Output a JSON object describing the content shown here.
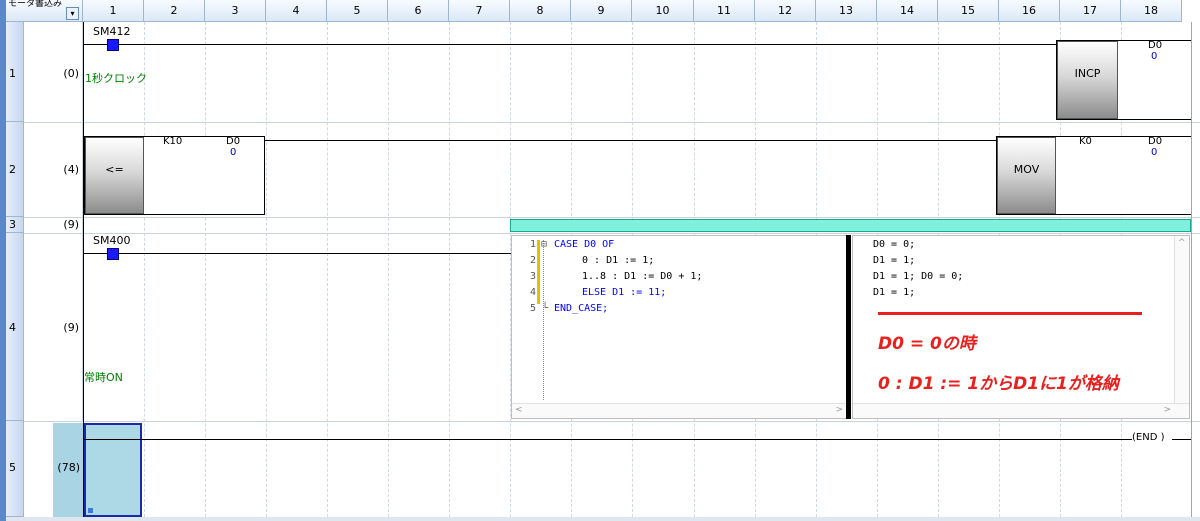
{
  "header": {
    "first_col": "モータ書込み",
    "dropdown_glyph": "▾",
    "columns": [
      "1",
      "2",
      "3",
      "4",
      "5",
      "6",
      "7",
      "8",
      "9",
      "10",
      "11",
      "12",
      "13",
      "14",
      "15",
      "16",
      "17",
      "18"
    ]
  },
  "rows": [
    {
      "no": "1",
      "step": "(0)"
    },
    {
      "no": "2",
      "step": "(4)"
    },
    {
      "no": "3",
      "step": "(9)"
    },
    {
      "no": "4",
      "step": "(9)"
    },
    {
      "no": "5",
      "step": "(78)"
    }
  ],
  "rung1": {
    "contact_device": "SM412",
    "contact_comment": "1秒クロック",
    "instruction": "INCP",
    "operand": "D0",
    "operand_value": "0"
  },
  "rung2": {
    "instruction": "<=",
    "operand1": "K10",
    "operand2": "D0",
    "operand2_value": "0",
    "instruction2": "MOV",
    "mov_src": "K0",
    "mov_dst": "D0",
    "mov_dst_value": "0"
  },
  "rung4": {
    "contact_device": "SM400",
    "contact_comment": "常時ON"
  },
  "st_code": {
    "lines": [
      {
        "no": "1",
        "fold": "⊟",
        "text": "CASE D0 OF"
      },
      {
        "no": "2",
        "fold": "",
        "text": "0 : D1 := 1;"
      },
      {
        "no": "3",
        "fold": "",
        "text": "1..8 : D1 := D0 + 1;"
      },
      {
        "no": "4",
        "fold": "",
        "text": "ELSE D1 := 11;"
      },
      {
        "no": "5",
        "fold": "└",
        "text": "END_CASE;"
      }
    ],
    "monitor": [
      "D0 = 0;",
      "D1 = 1;",
      "D1 = 1; D0 = 0;",
      "D1 = 1;"
    ]
  },
  "annotation": {
    "line1": "D0 = 0の時",
    "line2": "0 : D1 := 1からD1に1が格納",
    "color": "#e8201e"
  },
  "end_label": "END",
  "scroll_glyphs": {
    "left": "<",
    "right": ">",
    "up": "^",
    "down": "v"
  }
}
